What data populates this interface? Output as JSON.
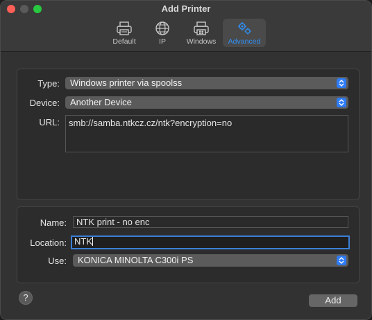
{
  "window": {
    "title": "Add Printer"
  },
  "toolbar": {
    "items": [
      {
        "label": "Default",
        "icon": "printer-icon"
      },
      {
        "label": "IP",
        "icon": "globe-icon"
      },
      {
        "label": "Windows",
        "icon": "windows-printer-icon"
      },
      {
        "label": "Advanced",
        "icon": "gears-icon",
        "selected": true
      }
    ]
  },
  "connection": {
    "type_label": "Type:",
    "type_value": "Windows printer via spoolss",
    "device_label": "Device:",
    "device_value": "Another Device",
    "url_label": "URL:",
    "url_value": "smb://samba.ntkcz.cz/ntk?encryption=no"
  },
  "details": {
    "name_label": "Name:",
    "name_value": "NTK print - no enc",
    "location_label": "Location:",
    "location_value": "NTK",
    "use_label": "Use:",
    "use_value": "KONICA MINOLTA C300i PS"
  },
  "footer": {
    "help_label": "?",
    "add_label": "Add"
  },
  "colors": {
    "accent": "#2f8ff5",
    "popup_arrow": "#2e7cf6",
    "focus_ring": "#3b7fd6"
  }
}
